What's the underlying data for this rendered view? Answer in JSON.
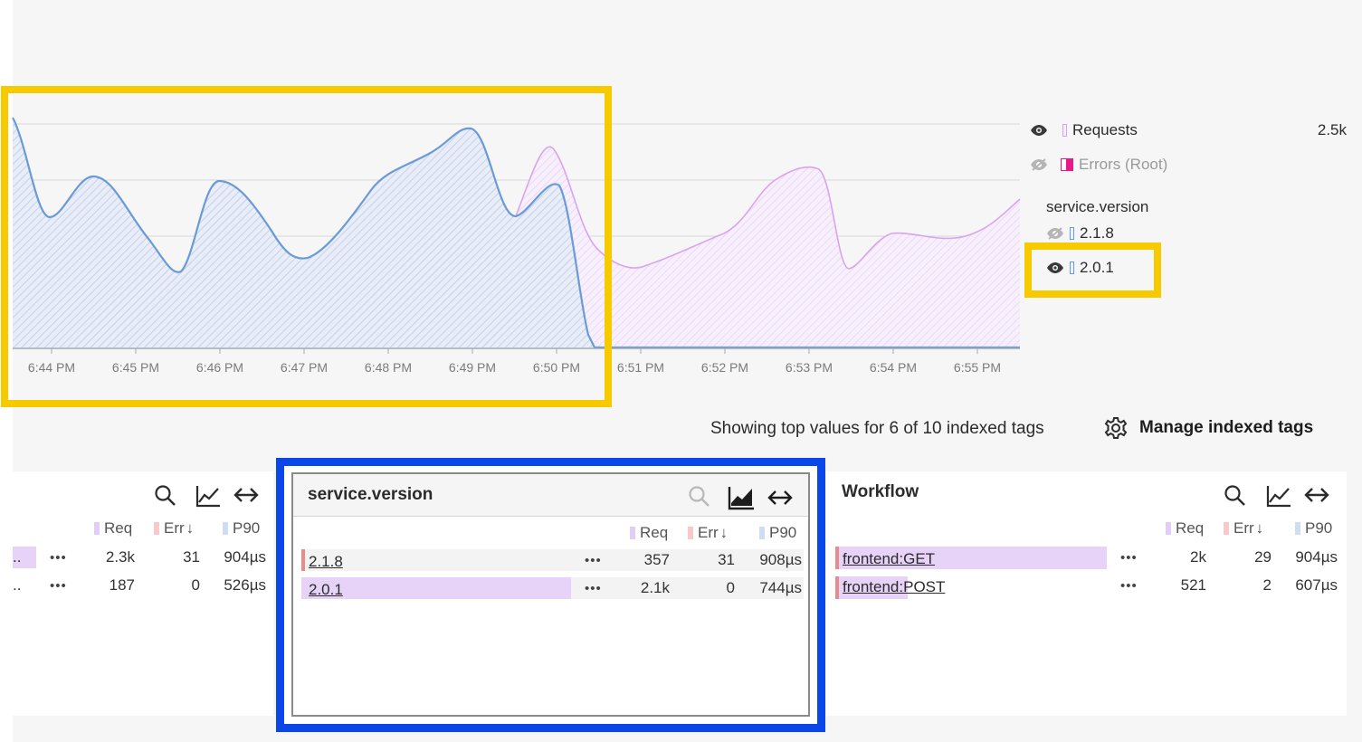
{
  "chart": {
    "x_ticks": [
      "6:44 PM",
      "6:45 PM",
      "6:46 PM",
      "6:47 PM",
      "6:48 PM",
      "6:49 PM",
      "6:50 PM",
      "6:51 PM",
      "6:52 PM",
      "6:53 PM",
      "6:54 PM",
      "6:55 PM"
    ],
    "series_colors": {
      "version_201": "#6b9bd6",
      "requests": "#d9a3f0",
      "errors": "#e8198b"
    }
  },
  "legend": {
    "requests_label": "Requests",
    "requests_value": "2.5k",
    "errors_label": "Errors (Root)",
    "group_title": "service.version",
    "versions": [
      "2.1.8",
      "2.0.1"
    ]
  },
  "tags_bar": {
    "summary": "Showing top values for 6 of 10 indexed tags",
    "manage_label": "Manage indexed tags"
  },
  "columns": {
    "req": "Req",
    "err": "Err",
    "p90": "P90"
  },
  "left_panel": {
    "rows": [
      {
        "label": "..",
        "req": "2.3k",
        "err": "31",
        "p90": "904µs"
      },
      {
        "label": "..",
        "req": "187",
        "err": "0",
        "p90": "526µs"
      }
    ]
  },
  "center_panel": {
    "title": "service.version",
    "rows": [
      {
        "label": "2.1.8",
        "req": "357",
        "err": "31",
        "p90": "908µs"
      },
      {
        "label": "2.0.1",
        "req": "2.1k",
        "err": "0",
        "p90": "744µs"
      }
    ]
  },
  "right_panel": {
    "title": "Workflow",
    "rows": [
      {
        "label": "frontend:GET",
        "req": "2k",
        "err": "29",
        "p90": "904µs"
      },
      {
        "label": "frontend:POST",
        "req": "521",
        "err": "2",
        "p90": "607µs"
      }
    ]
  },
  "row_menu": "•••"
}
